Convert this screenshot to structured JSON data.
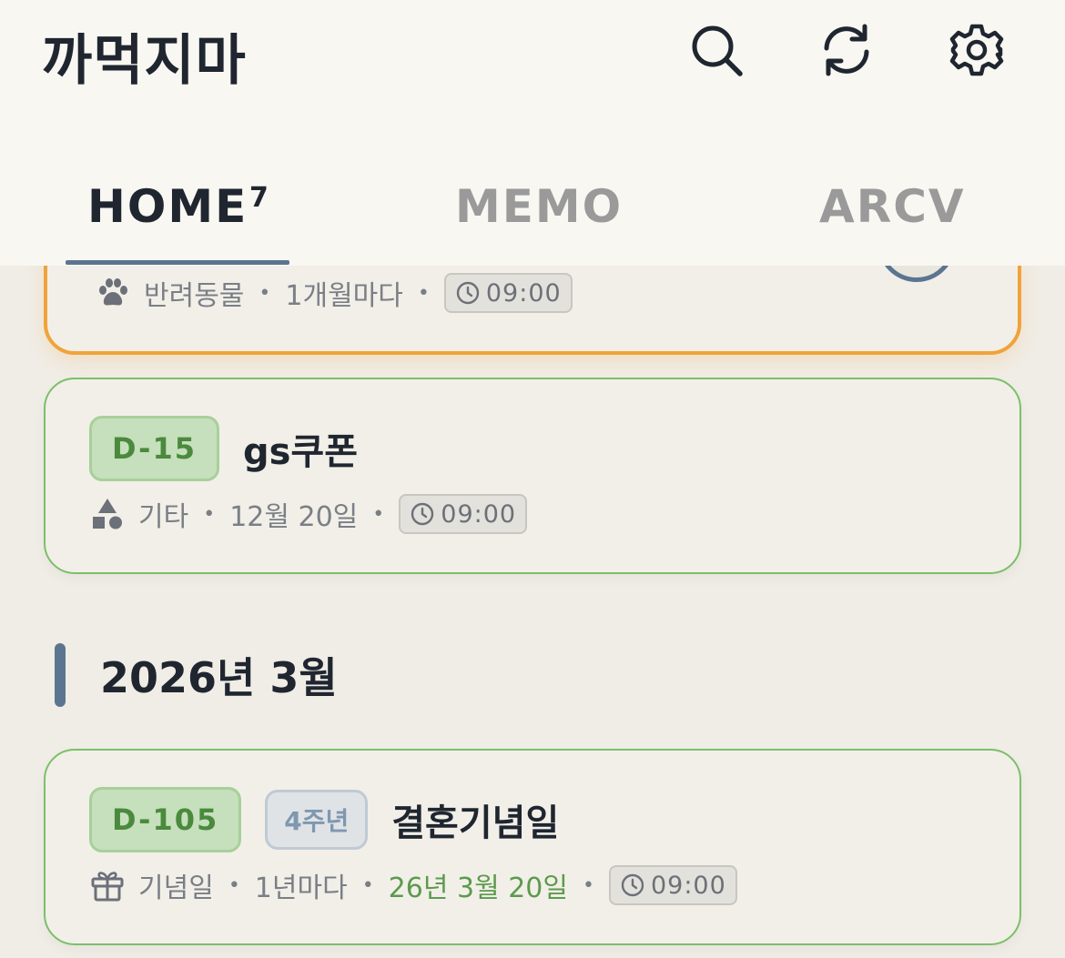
{
  "header": {
    "title": "까먹지마",
    "icons": {
      "search": "search-icon",
      "refresh": "refresh-icon",
      "settings": "gear-icon"
    }
  },
  "tabs": [
    {
      "label": "HOME",
      "badge": "7",
      "active": true
    },
    {
      "label": "MEMO",
      "active": false
    },
    {
      "label": "ARCV",
      "active": false
    }
  ],
  "colors": {
    "accent": "#5b7590",
    "highlight_border": "#f0a33a",
    "card_border": "#7cbf6a",
    "dday_text": "#4a8a3c",
    "date_green": "#5c9a4e"
  },
  "items": [
    {
      "category_icon": "paw-icon",
      "category": "반려동물",
      "repeat": "1개월마다",
      "time": "09:00",
      "highlighted": true
    },
    {
      "dday": "D-15",
      "title": "gs쿠폰",
      "category_icon": "shapes-icon",
      "category": "기타",
      "date": "12월 20일",
      "time": "09:00"
    }
  ],
  "section": {
    "title": "2026년 3월"
  },
  "section_items": [
    {
      "dday": "D-105",
      "anniversary": "4주년",
      "title": "결혼기념일",
      "category_icon": "gift-icon",
      "category": "기념일",
      "repeat": "1년마다",
      "date": "26년 3월 20일",
      "time": "09:00"
    }
  ],
  "separator": "•"
}
